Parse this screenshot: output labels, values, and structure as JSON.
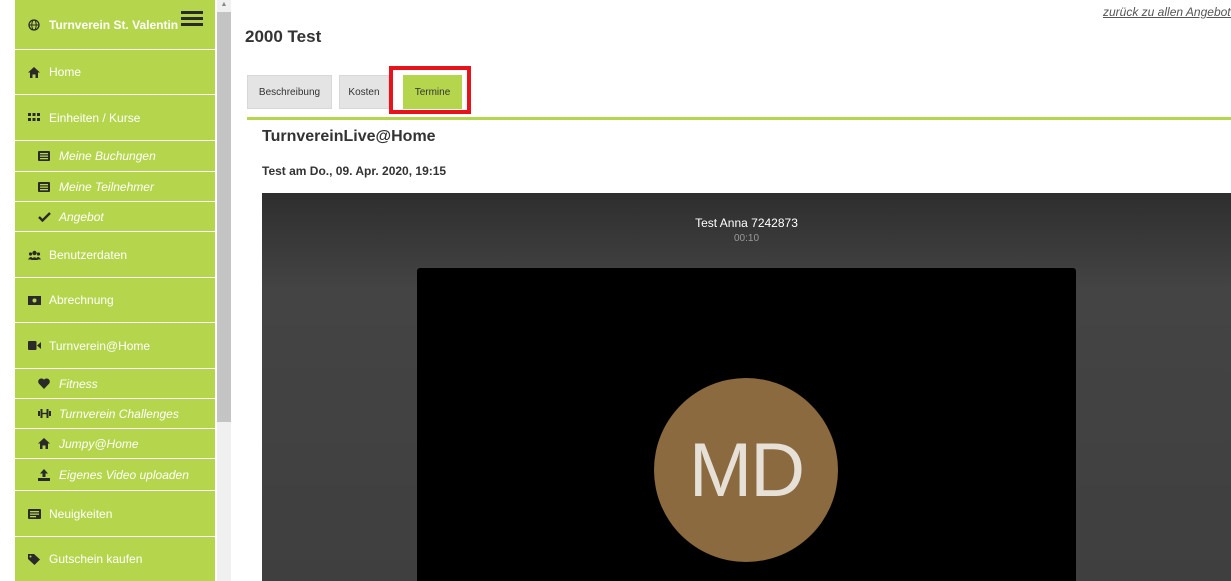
{
  "sidebar": {
    "brand": "Turnverein St. Valentin",
    "items": [
      {
        "label": "Home",
        "icon": "home-icon"
      },
      {
        "label": "Einheiten / Kurse",
        "icon": "grid-icon"
      },
      {
        "label": "Meine Buchungen",
        "icon": "list-icon"
      },
      {
        "label": "Meine Teilnehmer",
        "icon": "list-icon"
      },
      {
        "label": "Angebot",
        "icon": "check-icon"
      },
      {
        "label": "Benutzerdaten",
        "icon": "users-icon"
      },
      {
        "label": "Abrechnung",
        "icon": "money-icon"
      },
      {
        "label": "Turnverein@Home",
        "icon": "video-icon"
      },
      {
        "label": "Fitness",
        "icon": "heart-icon"
      },
      {
        "label": "Turnverein Challenges",
        "icon": "dumbbell-icon"
      },
      {
        "label": "Jumpy@Home",
        "icon": "home-icon"
      },
      {
        "label": "Eigenes Video uploaden",
        "icon": "upload-icon"
      },
      {
        "label": "Neuigkeiten",
        "icon": "newspaper-icon"
      },
      {
        "label": "Gutschein kaufen",
        "icon": "tag-icon"
      }
    ]
  },
  "header": {
    "title": "2000 Test",
    "back_link": "zurück zu allen Angeboten"
  },
  "tabs": [
    {
      "label": "Beschreibung"
    },
    {
      "label": "Kosten"
    },
    {
      "label": "Termine",
      "active": true
    }
  ],
  "main": {
    "section_title": "TurnvereinLive@Home",
    "session": "Test am Do., 09. Apr. 2020, 19:15"
  },
  "video_call": {
    "caller_name": "Test Anna 7242873",
    "duration": "00:10",
    "avatar_initials": "MD"
  },
  "colors": {
    "accent_green": "#b5d64c",
    "highlight_red": "#e8121a",
    "avatar_bg": "#8a6a3e"
  }
}
